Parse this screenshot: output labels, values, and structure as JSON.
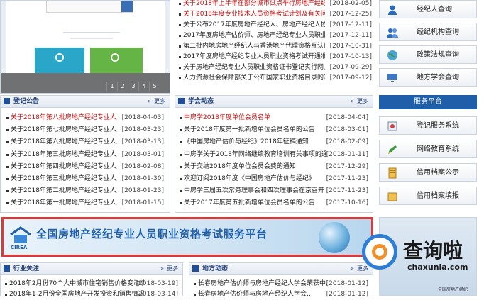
{
  "banner": {
    "pages": [
      "1",
      "2",
      "3",
      "4",
      "5"
    ]
  },
  "top_news": [
    {
      "title": "关于2018年上半年在部分城市试点举行房地产经纪专业…",
      "date": "[2018-02-05]",
      "red": true
    },
    {
      "title": "关于2018年度专业技术人员资格考试计划及有关问题的…",
      "date": "[2017-12-25]",
      "red": true
    },
    {
      "title": "关于公布2017年度房地产经纪人、房地产经纪人协理职…",
      "date": "[2017-12-11]",
      "red": false
    },
    {
      "title": "2017年度房地产估价师、房地产经纪专业人员职业资格…",
      "date": "[2017-12-11]",
      "red": false
    },
    {
      "title": "第二批内地房地产经纪人与香港地产代理资格互认面授…",
      "date": "[2017-10-31]",
      "red": false
    },
    {
      "title": "2017年度房地产经纪专业人员职业资格考试开通准考证…",
      "date": "[2017-10-13]",
      "red": false
    },
    {
      "title": "关于房地产经纪专业人员职业资格证书登记实行网上办…",
      "date": "[2017-09-29]",
      "red": false
    },
    {
      "title": "人力资源社会保障部关于公布国家职业资格目录的通知",
      "date": "[2017-09-12]",
      "red": false
    }
  ],
  "registration": {
    "title": "登记公告",
    "more": "更多",
    "items": [
      {
        "title": "关于2018年第八批房地产经纪专业人员…",
        "date": "[2018-04-03]",
        "red": true
      },
      {
        "title": "关于2018年第七批房地产经纪专业人员…",
        "date": "[2018-03-23]",
        "red": false
      },
      {
        "title": "关于2018年第六批房地产经纪专业人员…",
        "date": "[2018-03-13]",
        "red": false
      },
      {
        "title": "关于2018年第五批房地产经纪专业人员…",
        "date": "[2018-03-01]",
        "red": false
      },
      {
        "title": "关于2018年第四批房地产经纪专业人员…",
        "date": "[2018-02-08]",
        "red": false
      },
      {
        "title": "关于2018年第三批房地产经纪专业人员…",
        "date": "[2018-01-30]",
        "red": false
      },
      {
        "title": "关于2018年第二批房地产经纪专业人员…",
        "date": "[2018-01-23]",
        "red": false
      },
      {
        "title": "关于2018年第一批房地产经纪专业人员…",
        "date": "[2018-01-15]",
        "red": false
      }
    ]
  },
  "society": {
    "title": "学会动态",
    "more": "更多",
    "items": [
      {
        "title": "中房学2018年度单位会员名单",
        "date": "[2018-04-04]",
        "red": true
      },
      {
        "title": "关于2018年度第一批新增单位会员名单的公告",
        "date": "[2018-03-01]",
        "red": false
      },
      {
        "title": "《中国房地产估价与经纪》2018年征稿通知",
        "date": "[2018-02-09]",
        "red": false
      },
      {
        "title": "中房学关于2018年网络继续教育培训有关事项的通知",
        "date": "[2018-01-11]",
        "red": false
      },
      {
        "title": "关于交纳2018年度单位会员会费的通知",
        "date": "[2017-12-29]",
        "red": false
      },
      {
        "title": "欢迎订阅2018年度《中国房地产估价与经纪》",
        "date": "[2017-11-23]",
        "red": false
      },
      {
        "title": "中房学三届五次常务理事会和四次理事会在京召开",
        "date": "[2017-11-23]",
        "red": false
      },
      {
        "title": "关于2017年度第五批新增单位会员名单的公告",
        "date": "[2017-10-16]",
        "red": false
      }
    ]
  },
  "sidebar": {
    "top_items": [
      {
        "label": "经纪人查询"
      },
      {
        "label": "经纪机构查询"
      },
      {
        "label": "政策法规查询"
      },
      {
        "label": "地方学会查询"
      }
    ],
    "service_title": "服务平台",
    "service_items": [
      {
        "label": "登记服务系统"
      },
      {
        "label": "网络教育系统"
      },
      {
        "label": "信用档案公示"
      },
      {
        "label": "信用档案填报"
      }
    ]
  },
  "cirea": {
    "logo_text": "CIREA",
    "title": "全国房地产经纪专业人员职业资格考试服务平台"
  },
  "industry": {
    "title": "行业关注",
    "more": "更多",
    "items": [
      {
        "title": "2018年2月份70个大中城市住宅销售价格变动情况",
        "date": "[2018-03-19]"
      },
      {
        "title": "2018年1-2月份全国房地产开发投资和销售情况",
        "date": "[2018-03-14]"
      }
    ]
  },
  "local": {
    "title": "地方动态",
    "more": "更多",
    "items": [
      {
        "title": "长春房地产估价师与房地产经纪人学会荣获中…",
        "date": "[2018-01-12]"
      },
      {
        "title": "长春房地产估价师与房地产经纪人学会…",
        "date": "[2018-01-12]"
      }
    ]
  },
  "watermark": {
    "text": "查询啦",
    "url": "chaxunla.com"
  },
  "right_ad": {
    "small_text": "全国房地产经纪"
  },
  "colors": {
    "accent": "#1f5ea8",
    "red": "#c81010",
    "banner_border": "#d93a3a"
  }
}
